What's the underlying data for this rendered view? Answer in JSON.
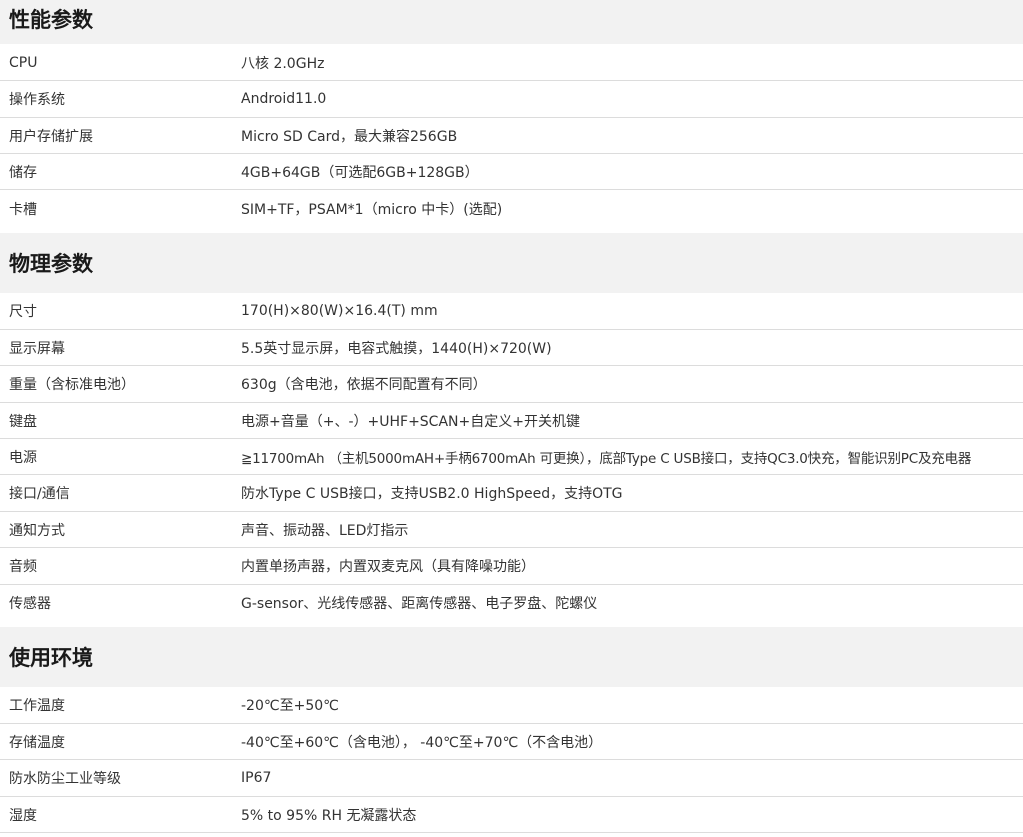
{
  "sections": [
    {
      "title": "性能参数",
      "rows": [
        {
          "label": "CPU",
          "value": "八核 2.0GHz"
        },
        {
          "label": "操作系统",
          "value": "Android11.0"
        },
        {
          "label": "用户存储扩展",
          "value": "Micro SD Card，最大兼容256GB"
        },
        {
          "label": "储存",
          "value": "4GB+64GB（可选配6GB+128GB）"
        },
        {
          "label": "卡槽",
          "value": "SIM+TF，PSAM*1（micro 中卡）(选配)"
        }
      ]
    },
    {
      "title": "物理参数",
      "rows": [
        {
          "label": "尺寸",
          "value": "170(H)×80(W)×16.4(T) mm"
        },
        {
          "label": "显示屏幕",
          "value": "5.5英寸显示屏，电容式触摸，1440(H)×720(W)"
        },
        {
          "label": "重量（含标准电池）",
          "value": "630g（含电池，依据不同配置有不同）"
        },
        {
          "label": "键盘",
          "value": "电源+音量（+、-）+UHF+SCAN+自定义+开关机键"
        },
        {
          "label": "电源",
          "value": "≧11700mAh （主机5000mAH+手柄6700mAh 可更换），底部Type C USB接口，支持QC3.0快充，智能识别PC及充电器"
        },
        {
          "label": "接口/通信",
          "value": "防水Type C USB接口，支持USB2.0 HighSpeed，支持OTG"
        },
        {
          "label": "通知方式",
          "value": "声音、振动器、LED灯指示"
        },
        {
          "label": "音频",
          "value": "内置单扬声器，内置双麦克风（具有降噪功能）"
        },
        {
          "label": "传感器",
          "value": "G-sensor、光线传感器、距离传感器、电子罗盘、陀螺仪"
        }
      ]
    },
    {
      "title": "使用环境",
      "rows": [
        {
          "label": "工作温度",
          "value": "-20℃至+50℃"
        },
        {
          "label": "存储温度",
          "value": "-40℃至+60℃（含电池）， -40℃至+70℃（不含电池）"
        },
        {
          "label": "防水防尘工业等级",
          "value": "IP67"
        },
        {
          "label": "湿度",
          "value": "5% to 95% RH 无凝露状态"
        }
      ]
    }
  ]
}
